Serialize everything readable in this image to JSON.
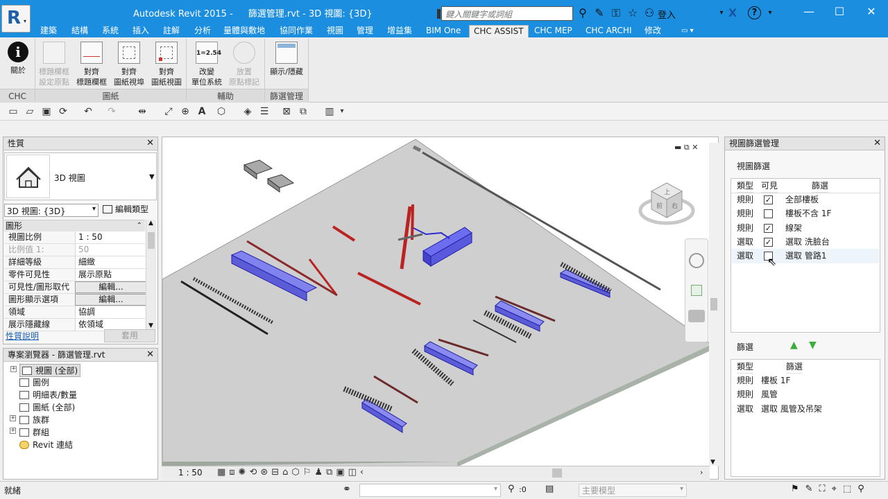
{
  "titlebar": {
    "app_name": "Autodesk Revit 2015 -",
    "file_name": "篩選管理.rvt - 3D 視圖: {3D}",
    "search_placeholder": "鍵入關鍵字或詞組",
    "login_label": "登入",
    "bg_color": "#1c8ee0"
  },
  "tabs": [
    "建築",
    "結構",
    "系統",
    "插入",
    "註解",
    "分析",
    "量體與敷地",
    "協同作業",
    "視圖",
    "管理",
    "增益集",
    "BIM One",
    "CHC ASSIST",
    "CHC MEP",
    "CHC ARCHI",
    "修改"
  ],
  "active_tab": "CHC ASSIST",
  "ribbon": {
    "about_line1": "關於",
    "b1_line1": "標題欄框",
    "b1_line2": "設定原點",
    "b2_line1": "對齊",
    "b2_line2": "標題欄框",
    "b3_line1": "對齊",
    "b3_line2": "圖紙視埠",
    "b4_line1": "對齊",
    "b4_line2": "圖紙視圖",
    "b5_icon_text": "1=2.54",
    "b5_line1": "改變",
    "b5_line2": "單位系統",
    "b6_line1": "放置",
    "b6_line2": "原點標記",
    "b7_line1": "顯示/隱藏",
    "panel_chc": "CHC",
    "panel_sheet": "圖紙",
    "panel_aux": "輔助",
    "panel_filter": "篩選管理"
  },
  "properties": {
    "header": "性質",
    "type_name": "3D 視圖",
    "selector": "3D 視圖: {3D}",
    "edit_type": "編輯類型",
    "group": "圖形",
    "rows": [
      {
        "k": "視圖比例",
        "v": "1 : 50"
      },
      {
        "k": "比例值 1:",
        "v": "50"
      },
      {
        "k": "詳細等級",
        "v": "細緻"
      },
      {
        "k": "零件可見性",
        "v": "展示原點"
      },
      {
        "k": "可見性/圖形取代",
        "v": "編輯..."
      },
      {
        "k": "圖形顯示選項",
        "v": "編輯..."
      },
      {
        "k": "領域",
        "v": "協調"
      },
      {
        "k": "展示隱藏線",
        "v": "依領域"
      }
    ],
    "help_link": "性質說明",
    "apply_label": "套用"
  },
  "browser": {
    "header": "專案瀏覽器 - 篩選管理.rvt",
    "items": [
      "視圖 (全部)",
      "圖例",
      "明細表/數量",
      "圖紙 (全部)",
      "族群",
      "群組",
      "Revit 連結"
    ]
  },
  "viewport": {
    "scale_label": "1 : 50",
    "cube_face_top": "上",
    "cube_face_front": "前",
    "cube_face_right": "右"
  },
  "filter_panel": {
    "header": "視圖篩選管理",
    "view_filter_title": "視圖篩選",
    "col_type": "類型",
    "col_visible": "可見",
    "col_filter": "篩選",
    "rows": [
      {
        "type": "規則",
        "visible": true,
        "name": "全部樓板"
      },
      {
        "type": "規則",
        "visible": false,
        "name": "樓板不含 1F"
      },
      {
        "type": "規則",
        "visible": true,
        "name": "線架"
      },
      {
        "type": "選取",
        "visible": true,
        "name": "選取 洗臉台"
      },
      {
        "type": "選取",
        "visible": false,
        "name": "選取 管路1"
      }
    ],
    "filter_title": "篩選",
    "filter_rows": [
      {
        "type": "規則",
        "name": "樓板 1F"
      },
      {
        "type": "規則",
        "name": "風管"
      },
      {
        "type": "選取",
        "name": "選取 風管及吊架"
      }
    ]
  },
  "statusbar": {
    "ready": "就緒",
    "sel_count": ":0",
    "model_placeholder": "主要模型"
  }
}
